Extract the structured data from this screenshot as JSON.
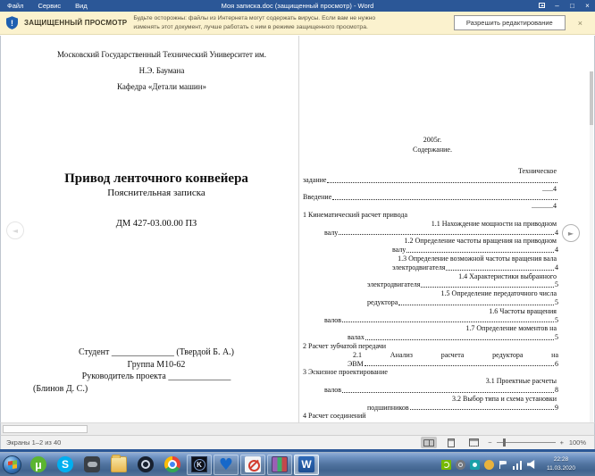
{
  "colors": {
    "accent": "#2b5797",
    "banner_bg": "#fbf2ce",
    "taskbar_top": "#8fadd6"
  },
  "titlebar": {
    "title": "Моя записка.doc (защищенный просмотр) - Word",
    "menu": [
      {
        "label": "Файл"
      },
      {
        "label": "Сервис"
      },
      {
        "label": "Вид"
      }
    ],
    "minimize": "–",
    "maximize": "□",
    "close": "×"
  },
  "banner": {
    "label": "ЗАЩИЩЕННЫЙ ПРОСМОТР",
    "message": "Будьте осторожны: файлы из Интернета могут содержать вирусы. Если вам не нужно изменять этот документ, лучше работать с ним в режиме защищенного просмотра.",
    "button": "Разрешить редактирование",
    "close": "×"
  },
  "nav": {
    "prev": "◄",
    "next": "►"
  },
  "left_page": {
    "university_line1": "Московский Государственный Технический Университет им.",
    "university_line2": "Н.Э. Баумана",
    "department": "Кафедра «Детали машин»",
    "title": "Привод ленточного конвейера",
    "subtitle": "Пояснительная записка",
    "doc_code": "ДМ 427-03.00.00 ПЗ",
    "student_line": "Студент ______________ (Твердой Б. А.)",
    "group_line": "Группа М10-62",
    "supervisor_line": "Руководитель проекта ______________",
    "supervisor_name": "(Блинов Д. С.)"
  },
  "right_page": {
    "year": "2005г.",
    "heading": "Содержание.",
    "toc": [
      {
        "style": "right",
        "t": "Техническое"
      },
      {
        "style": "left",
        "t": "задание",
        "d": true
      },
      {
        "style": "right",
        "t": "......4"
      },
      {
        "style": "left",
        "t": "Введение",
        "d": true
      },
      {
        "style": "right",
        "t": "............4"
      },
      {
        "style": "left",
        "t": "1 Кинематический расчет привода"
      },
      {
        "style": "right",
        "t": "1.1 Нахождение мощности на приводном"
      },
      {
        "style": "i1",
        "t": "валу",
        "d": true,
        "n": "4"
      },
      {
        "style": "right",
        "t": "1.2 Определение частоты вращения на приводном"
      },
      {
        "style": "i4",
        "t": "валу",
        "d": true,
        "n": "4"
      },
      {
        "style": "right",
        "t": "1.3 Определение возможной частоты вращения вала"
      },
      {
        "style": "i4",
        "t": "электродвигателя",
        "d": true,
        "n": "4"
      },
      {
        "style": "right",
        "t": "1.4 Характеристики выбранного"
      },
      {
        "style": "i3",
        "t": "электродвигателя",
        "d": true,
        "n": "5"
      },
      {
        "style": "right",
        "t": "1.5 Определение передаточного числа"
      },
      {
        "style": "i3",
        "t": "редуктора",
        "d": true,
        "n": "5"
      },
      {
        "style": "right",
        "t": "1.6 Частоты вращения"
      },
      {
        "style": "i1",
        "t": "валов",
        "d": true,
        "n": "5"
      },
      {
        "style": "right",
        "t": "1.7 Определение моментов на"
      },
      {
        "style": "i2",
        "t": "валах",
        "d": true,
        "n": "5"
      },
      {
        "style": "left",
        "t": "2 Расчет зубчатой передачи"
      },
      {
        "style": "justify",
        "t": "2.1 Анализ расчета редуктора на"
      },
      {
        "style": "i2",
        "t": "ЭВМ",
        "d": true,
        "n": "6"
      },
      {
        "style": "left",
        "t": "3 Эскизное проектирование"
      },
      {
        "style": "right",
        "t": "3.1 Проектные расчеты"
      },
      {
        "style": "i1",
        "t": "валов",
        "d": true,
        "n": "8"
      },
      {
        "style": "right",
        "t": "3.2 Выбор типа и схема установки"
      },
      {
        "style": "i3",
        "t": "подшипников",
        "d": true,
        "n": "9"
      },
      {
        "style": "left",
        "t": "4  Расчет соединений"
      }
    ]
  },
  "statusbar": {
    "pages_indicator": "Экраны 1–2 из 40",
    "zoom_out": "−",
    "zoom_in": "+",
    "zoom_level": "100%"
  },
  "taskbar": {
    "apps": [
      {
        "icon": "utorrent-icon",
        "cls": "utorrent-ic",
        "glyph": "µ",
        "state": "plain"
      },
      {
        "icon": "skype-icon",
        "cls": "skype-ic",
        "glyph": "S",
        "state": "plain"
      },
      {
        "icon": "discord-icon",
        "cls": "discord-ic",
        "glyph": "",
        "state": "plain"
      },
      {
        "icon": "file-explorer-icon",
        "cls": "explorer-ic",
        "glyph": "",
        "state": "plain"
      },
      {
        "icon": "steam-icon",
        "cls": "steam-ic",
        "glyph": "",
        "state": "plain"
      },
      {
        "icon": "chrome-icon",
        "cls": "chrome-ic",
        "glyph": "",
        "state": "plain"
      },
      {
        "icon": "k-app-icon",
        "cls": "kapp-ic",
        "glyph": "K",
        "state": "open"
      },
      {
        "icon": "heart-app-icon",
        "cls": "heart-ic",
        "glyph": "♥",
        "state": "open"
      },
      {
        "icon": "blocked-app-icon",
        "cls": "blocked-ic",
        "glyph": "",
        "state": "open"
      },
      {
        "icon": "winrar-icon",
        "cls": "winrar-ic",
        "glyph": "",
        "state": "open"
      },
      {
        "icon": "word-icon",
        "cls": "word-ic",
        "glyph": "W",
        "state": "active"
      }
    ],
    "tray": [
      {
        "icon": "nvidia-tray-icon",
        "cls": "nvidia-tr"
      },
      {
        "icon": "steam-tray-icon",
        "cls": "steam-tr"
      },
      {
        "icon": "messenger-tray-icon",
        "cls": "msg-tr"
      },
      {
        "icon": "update-tray-icon",
        "cls": "upd-tr"
      },
      {
        "icon": "action-center-flag-icon",
        "cls": "flag-tr"
      },
      {
        "icon": "network-tray-icon",
        "cls": "net-tr"
      },
      {
        "icon": "volume-tray-icon",
        "cls": "vol-tr"
      }
    ],
    "clock_time": "22:28",
    "clock_date": "11.03.2020"
  }
}
